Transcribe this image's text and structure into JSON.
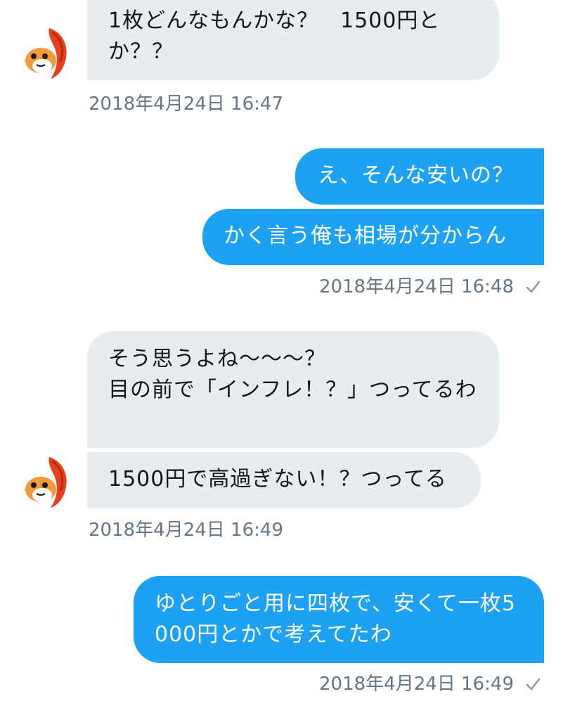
{
  "conversation": {
    "group1": {
      "msg1": "1枚どんなもんかな？　1500円とか？？",
      "time": "2018年4月24日 16:47"
    },
    "group2": {
      "msg1": "え、そんな安いの？",
      "msg2": "かく言う俺も相場が分からん",
      "time": "2018年4月24日 16:48"
    },
    "group3": {
      "msg1": "そう思うよね〜〜〜？\n目の前で「インフレ！？」つってるわ",
      "msg2": "1500円で高過ぎない！？つってる",
      "time": "2018年4月24日 16:49"
    },
    "group4": {
      "msg1": "ゆとりごと用に四枚で、安くて一枚5000円とかで考えてたわ",
      "time": "2018年4月24日 16:49"
    }
  },
  "icons": {
    "avatar": "koi-fish-avatar-icon",
    "read_receipt": "checkmark-icon"
  },
  "colors": {
    "incoming_bubble": "#e6ecf0",
    "outgoing_bubble": "#1da1f2",
    "timestamp": "#657786",
    "text": "#14171a"
  }
}
